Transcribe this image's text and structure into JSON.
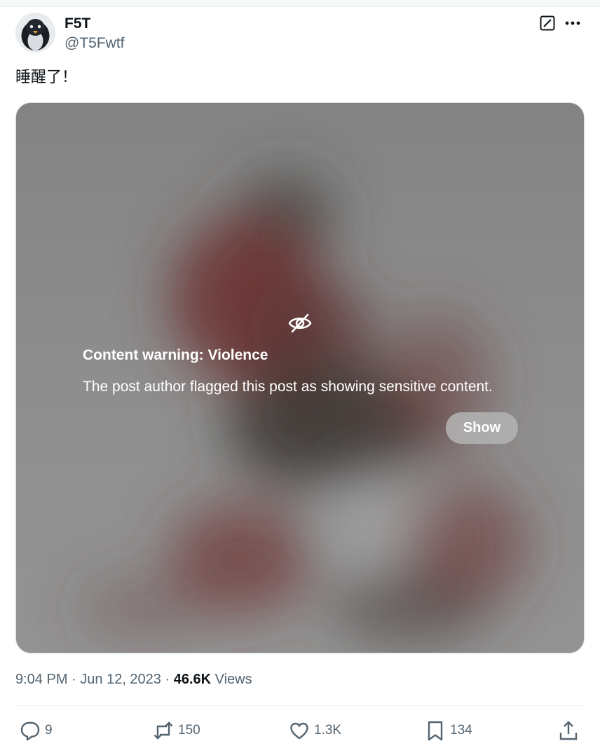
{
  "author": {
    "display_name": "F5T",
    "handle": "@T5Fwtf"
  },
  "post": {
    "text": "睡醒了！"
  },
  "media": {
    "warning_title": "Content warning: Violence",
    "warning_body": "The post author flagged this post as showing sensitive content.",
    "show_label": "Show"
  },
  "meta": {
    "time": "9:04 PM",
    "separator": " · ",
    "date": "Jun 12, 2023",
    "views_count": "46.6K",
    "views_label": "Views"
  },
  "actions": {
    "replies": "9",
    "reposts": "150",
    "likes": "1.3K",
    "bookmarks": "134"
  },
  "icons": {
    "grok": "grok-icon",
    "more": "more-icon",
    "eye_off": "eye-off-icon",
    "reply": "reply-icon",
    "repost": "repost-icon",
    "like": "heart-icon",
    "bookmark": "bookmark-icon",
    "share": "share-icon"
  },
  "colors": {
    "text_primary": "#0f1419",
    "text_secondary": "#536471",
    "media_overlay": "#8d8d8d"
  }
}
